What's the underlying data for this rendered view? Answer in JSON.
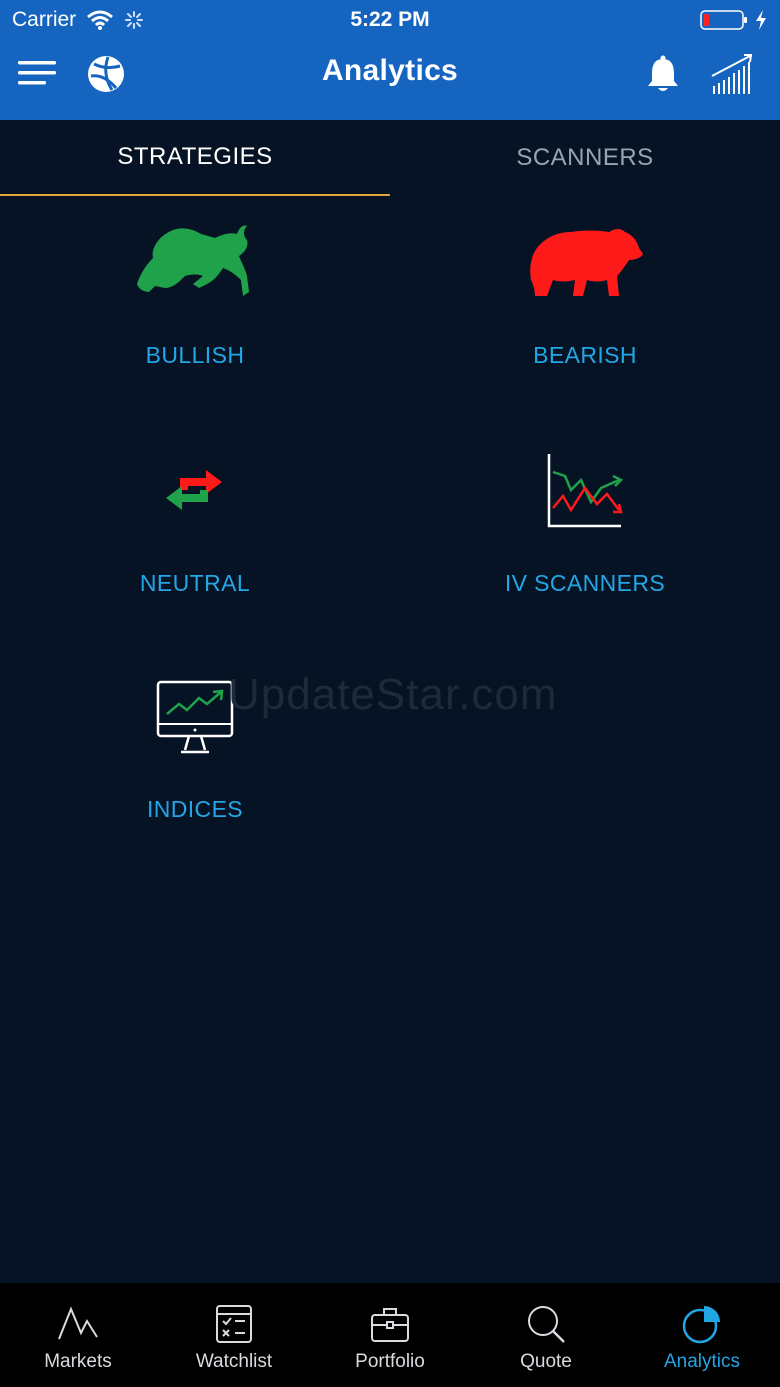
{
  "status_bar": {
    "carrier": "Carrier",
    "time": "5:22 PM"
  },
  "header": {
    "title": "Analytics",
    "icons": [
      "menu-icon",
      "globe-logo-icon",
      "bell-icon",
      "signal-chart-icon"
    ]
  },
  "tabs": [
    {
      "label": "STRATEGIES",
      "active": true
    },
    {
      "label": "SCANNERS",
      "active": false
    }
  ],
  "tiles": [
    {
      "label": "BULLISH",
      "icon": "bull-icon",
      "color": "#1fa24a"
    },
    {
      "label": "BEARISH",
      "icon": "bear-icon",
      "color": "#ff1a1a"
    },
    {
      "label": "NEUTRAL",
      "icon": "arrows-icon"
    },
    {
      "label": "IV SCANNERS",
      "icon": "line-chart-icon"
    },
    {
      "label": "INDICES",
      "icon": "monitor-chart-icon"
    }
  ],
  "watermark": "UpdateStar.com",
  "bottom_nav": [
    {
      "label": "Markets",
      "icon": "markets-icon"
    },
    {
      "label": "Watchlist",
      "icon": "watchlist-icon"
    },
    {
      "label": "Portfolio",
      "icon": "briefcase-icon"
    },
    {
      "label": "Quote",
      "icon": "search-icon"
    },
    {
      "label": "Analytics",
      "icon": "pie-chart-icon",
      "active": true
    }
  ],
  "colors": {
    "header_bg": "#1565c0",
    "page_bg": "#061325",
    "accent_label": "#23a6e6",
    "tab_indicator": "#e0a43a"
  }
}
